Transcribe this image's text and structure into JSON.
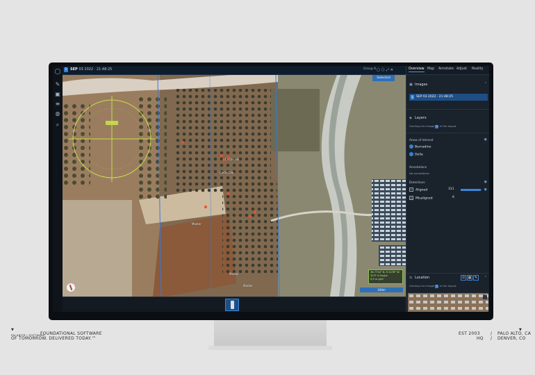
{
  "topbar": {
    "image_badge": "1",
    "date_label": "SEP",
    "date_value": "03 2022 · 21:48:25",
    "group_label": "Group A",
    "icons": [
      "picture-icon",
      "info-icon",
      "expand-icon",
      "close-icon"
    ],
    "selected_label": "Selected"
  },
  "map": {
    "labels": [
      "Coca‑Cola",
      "Coca‑Cola",
      "Marker",
      "Marker",
      "Marker"
    ],
    "coords_lines": [
      "38.7734° N, 9.1276° W",
      "31TF 0.5m/px",
      "0.5 m grid"
    ],
    "scale_label": "100m"
  },
  "toolbar": {
    "icons": [
      "logo-icon",
      "annotate-icon",
      "image-icon",
      "layers-icon",
      "globe-icon",
      "search-icon"
    ]
  },
  "panel": {
    "tabs": [
      "Overview",
      "Map",
      "Annotate",
      "Adjust",
      "Reality"
    ],
    "images": {
      "title": "Images",
      "row_badge": "1",
      "row_label": "SEP 03 2022 · 21:48:25"
    },
    "layers": {
      "title": "Layers",
      "hint_before": "Overlays for image",
      "hint_badge": "1",
      "hint_after": "in the layout",
      "aoi_title": "Areas of Interest",
      "aoi_items": [
        "Bernadino",
        "Della"
      ],
      "annotations_title": "Annotations",
      "annotations_empty": "No annotations",
      "detections_title": "Detections",
      "detections": [
        {
          "label": "Aligned",
          "value": "311",
          "fraction": 0.98
        },
        {
          "label": "Misaligned",
          "value": "6",
          "fraction": 0.02
        }
      ]
    },
    "location": {
      "title": "Location",
      "hint_before": "Overlays for image",
      "hint_badge": "1",
      "hint_after": "in the layout"
    }
  },
  "footer": {
    "tagline_small": "PALANTIR | SOFTWARE",
    "tagline_1": "FOUNDATIONAL SOFTWARE",
    "tagline_2": "OF TOMORROW. DELIVERED TODAY.™",
    "est": "EST 2003",
    "hq": "HQ",
    "slash1": "/",
    "slash2": "/",
    "city1": "PALO ALTO, CA",
    "city2": "DENVER, CO"
  },
  "colors": {
    "accent": "#2f7bd1",
    "panel_bg": "#1a222c",
    "reticle": "#c8e04a",
    "page_bg": "#e4e4e4"
  }
}
